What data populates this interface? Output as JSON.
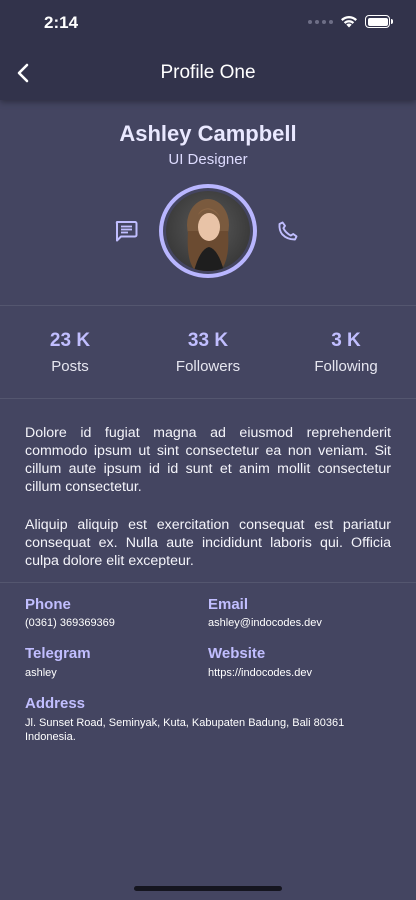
{
  "status_bar": {
    "time": "2:14"
  },
  "app_bar": {
    "title": "Profile One"
  },
  "profile": {
    "name": "Ashley Campbell",
    "role": "UI Designer"
  },
  "stats": [
    {
      "value": "23 K",
      "label": "Posts"
    },
    {
      "value": "33 K",
      "label": "Followers"
    },
    {
      "value": "3 K",
      "label": "Following"
    }
  ],
  "bio": {
    "paragraph1": "Dolore id fugiat magna ad eiusmod reprehenderit commodo ipsum ut sint consectetur ea non veniam. Sit cillum aute ipsum id id sunt et anim mollit consectetur cillum consectetur.",
    "paragraph2": "Aliquip aliquip est exercitation consequat est pariatur consequat ex. Nulla aute incididunt laboris qui. Officia culpa dolore elit excepteur."
  },
  "contact": {
    "phone": {
      "label": "Phone",
      "value": "(0361) 369369369"
    },
    "email": {
      "label": "Email",
      "value": "ashley@indocodes.dev"
    },
    "telegram": {
      "label": "Telegram",
      "value": "ashley"
    },
    "website": {
      "label": "Website",
      "value": "https://indocodes.dev"
    },
    "address": {
      "label": "Address",
      "value": "Jl. Sunset Road, Seminyak, Kuta, Kabupaten Badung, Bali 80361 Indonesia."
    }
  },
  "icons": {
    "back": "chevron-left-icon",
    "message": "message-icon",
    "call": "phone-icon"
  },
  "colors": {
    "background": "#444561",
    "header": "#32334b",
    "accent": "#c1beff",
    "avatar_ring": "#b9b6ff"
  }
}
